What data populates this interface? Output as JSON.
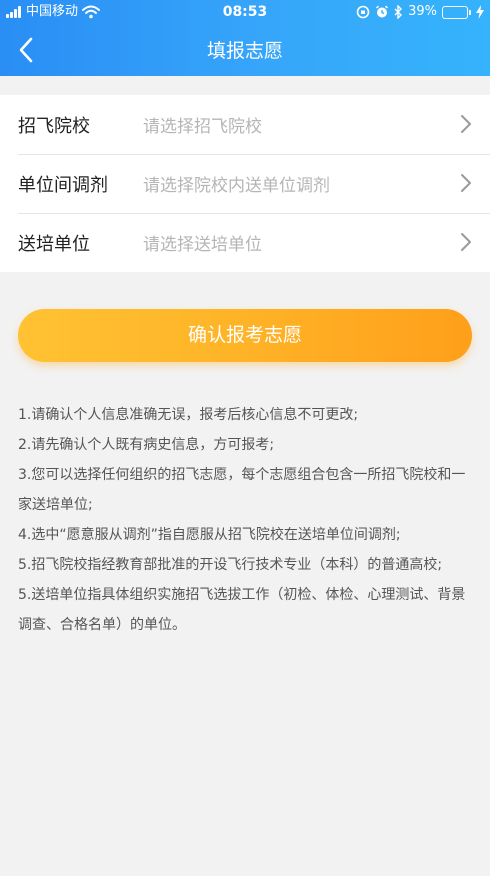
{
  "status_bar": {
    "carrier": "中国移动",
    "time": "08:53",
    "battery_percent": "39%",
    "battery_level": 0.39
  },
  "header": {
    "title": "填报志愿",
    "background_colors": [
      "#2a8ef5",
      "#35b3fb"
    ]
  },
  "form": {
    "rows": [
      {
        "label": "招飞院校",
        "placeholder": "请选择招飞院校"
      },
      {
        "label": "单位间调剂",
        "placeholder": "请选择院校内送单位调剂"
      },
      {
        "label": "送培单位",
        "placeholder": "请选择送培单位"
      }
    ]
  },
  "confirm_button": {
    "label": "确认报考志愿",
    "colors": [
      "#ffc233",
      "#ff9f1a"
    ]
  },
  "notes": [
    "1.请确认个人信息准确无误，报考后核心信息不可更改;",
    "2.请先确认个人既有病史信息，方可报考;",
    "3.您可以选择任何组织的招飞志愿，每个志愿组合包含一所招飞院校和一家送培单位;",
    "4.选中“愿意服从调剂”指自愿服从招飞院校在送培单位间调剂;",
    "5.招飞院校指经教育部批准的开设飞行技术专业（本科）的普通高校;",
    "5.送培单位指具体组织实施招飞选拔工作（初检、体检、心理测试、背景调查、合格名单）的单位。"
  ]
}
